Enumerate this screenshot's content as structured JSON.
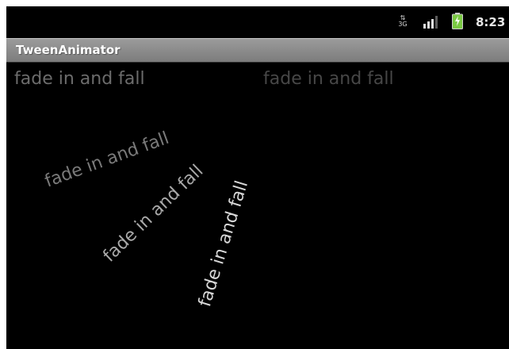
{
  "status_bar": {
    "network_type": "3G",
    "time": "8:23",
    "icons": [
      "network-type-icon",
      "signal-icon",
      "battery-charging-icon"
    ],
    "colors": {
      "battery": "#7ac943",
      "signal": "#e0e0e0"
    }
  },
  "app": {
    "title": "TweenAnimator"
  },
  "animation": {
    "items": [
      {
        "label": "fade in and fall"
      },
      {
        "label": "fade in and fall"
      },
      {
        "label": "fade in and fall"
      },
      {
        "label": "fade in and fall"
      },
      {
        "label": "fade in and fall"
      }
    ]
  }
}
